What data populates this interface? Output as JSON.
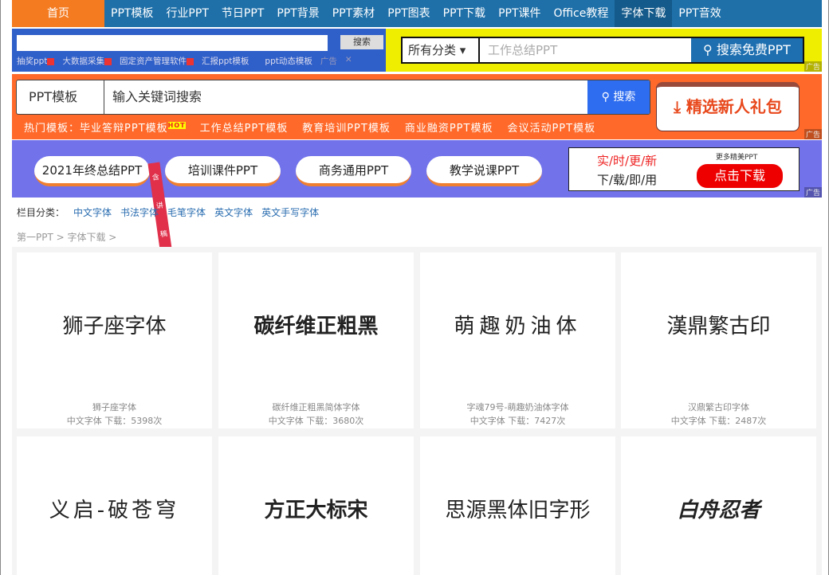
{
  "nav": [
    "首页",
    "PPT模板",
    "行业PPT",
    "节日PPT",
    "PPT背景",
    "PPT素材",
    "PPT图表",
    "PPT下载",
    "PPT课件",
    "Office教程",
    "字体下载",
    "PPT音效"
  ],
  "ad1": {
    "search_label": "搜索",
    "links": [
      "抽奖ppt",
      "大数据采集",
      "固定资产管理软件",
      "汇报ppt模板",
      "ppt动态模板"
    ],
    "ad_tag": "广告",
    "close": "✕"
  },
  "ad2": {
    "category": "所有分类 ▾",
    "placeholder": "工作总结PPT",
    "button": "搜索免费PPT",
    "ad_tag": "广告"
  },
  "search": {
    "type": "PPT模板",
    "placeholder": "输入关键词搜索",
    "button": "搜索",
    "hot_label": "热门模板：",
    "hot": [
      "毕业答辩PPT模板",
      "工作总结PPT模板",
      "教育培训PPT模板",
      "商业融资PPT模板",
      "会议活动PPT模板"
    ],
    "hot_badge": "HOT",
    "gift": "精选新人礼包",
    "ad_tag": "广告"
  },
  "banner": {
    "pills": [
      "2021年终总结PPT",
      "培训课件PPT",
      "商务通用PPT",
      "教学说课PPT"
    ],
    "badge": "含讲稿",
    "line1": "实/时/更/新",
    "line2": "下/载/即/用",
    "more": "更多精美PPT",
    "download": "点击下载",
    "ad_tag": "广告"
  },
  "categories": {
    "label": "栏目分类：",
    "items": [
      "中文字体",
      "书法字体",
      "毛笔字体",
      "英文字体",
      "英文手写字体"
    ]
  },
  "breadcrumb": "第一PPT > 字体下载 >",
  "fonts": [
    {
      "preview": "狮子座字体",
      "name": "狮子座字体",
      "meta": "中文字体  下载：5398次"
    },
    {
      "preview": "碳纤维正粗黑",
      "name": "碳纤维正粗黑简体字体",
      "meta": "中文字体  下载：3680次"
    },
    {
      "preview": "萌趣奶油体",
      "name": "字魂79号-萌趣奶油体字体",
      "meta": "中文字体  下载：7427次"
    },
    {
      "preview": "漢鼎繁古印",
      "name": "汉鼎繁古印字体",
      "meta": "中文字体  下载：2487次"
    },
    {
      "preview": "义启-破苍穹"
    },
    {
      "preview": "方正大标宋"
    },
    {
      "preview": "思源黑体旧字形"
    },
    {
      "preview": "白舟忍者"
    }
  ]
}
